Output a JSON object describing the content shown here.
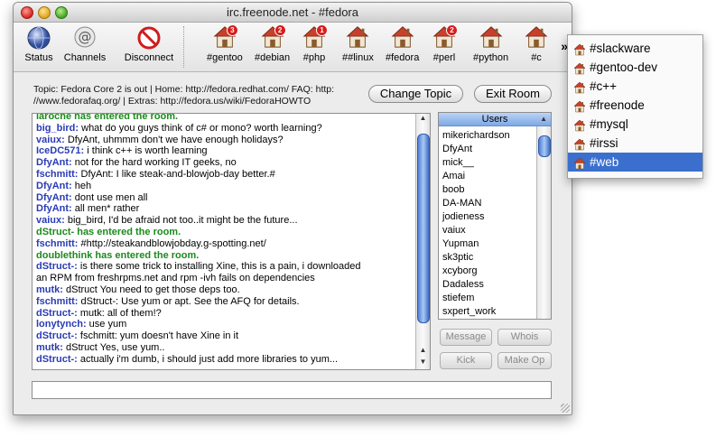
{
  "window": {
    "title": "irc.freenode.net - #fedora"
  },
  "toolbar": {
    "status_label": "Status",
    "channels_label": "Channels",
    "disconnect_label": "Disconnect",
    "overflow_glyph": "»",
    "channels": [
      {
        "name": "#gentoo",
        "badge": "3"
      },
      {
        "name": "#debian",
        "badge": "2"
      },
      {
        "name": "#php",
        "badge": "1"
      },
      {
        "name": "##linux",
        "badge": ""
      },
      {
        "name": "#fedora",
        "badge": ""
      },
      {
        "name": "#perl",
        "badge": "2"
      },
      {
        "name": "#python",
        "badge": ""
      },
      {
        "name": "#c",
        "badge": ""
      }
    ]
  },
  "topic": {
    "line1": "Topic: Fedora Core 2 is out | Home: http://fedora.redhat.com/ FAQ: http:",
    "line2": "//www.fedorafaq.org/ | Extras: http://fedora.us/wiki/FedoraHOWTO"
  },
  "buttons": {
    "change_topic": "Change Topic",
    "exit_room": "Exit Room",
    "message": "Message",
    "whois": "Whois",
    "kick": "Kick",
    "make_op": "Make Op"
  },
  "chat": [
    {
      "nick": "",
      "text": "laroche has entered the room.",
      "system": true
    },
    {
      "nick": "big_bird:",
      "text": " what do you guys think of c# or mono? worth learning?"
    },
    {
      "nick": "vaiux:",
      "text": " DfyAnt, uhmmm don't we have enough holidays?"
    },
    {
      "nick": "IceDC571:",
      "text": " i think c++ is worth learning"
    },
    {
      "nick": "DfyAnt:",
      "text": " not for the hard working IT geeks, no"
    },
    {
      "nick": "fschmitt:",
      "text": " DfyAnt: I like steak-and-blowjob-day better.#"
    },
    {
      "nick": "DfyAnt:",
      "text": " heh"
    },
    {
      "nick": "DfyAnt:",
      "text": " dont use men all"
    },
    {
      "nick": "DfyAnt:",
      "text": " all men* rather"
    },
    {
      "nick": "vaiux:",
      "text": " big_bird, I'd be afraid not too..it might be the future..."
    },
    {
      "nick": "",
      "text": "dStruct- has entered the room.",
      "system": true
    },
    {
      "nick": "fschmitt:",
      "text": " #http://steakandblowjobday.g-spotting.net/"
    },
    {
      "nick": "",
      "text": "doublethink has entered the room.",
      "system": true
    },
    {
      "nick": "dStruct-:",
      "text": " is there some trick to installing Xine, this is a pain, i downloaded"
    },
    {
      "nick": "",
      "text": "an RPM from freshrpms.net and rpm -ivh fails on dependencies"
    },
    {
      "nick": "mutk:",
      "text": " dStruct You need to get those deps too."
    },
    {
      "nick": "fschmitt:",
      "text": " dStruct-: Use yum or apt. See the AFQ for details."
    },
    {
      "nick": "dStruct-:",
      "text": " mutk: all of them!?"
    },
    {
      "nick": "lonytynch:",
      "text": " use yum"
    },
    {
      "nick": "dStruct-:",
      "text": " fschmitt: yum doesn't have Xine in it"
    },
    {
      "nick": "mutk:",
      "text": " dStruct Yes, use yum.."
    },
    {
      "nick": "dStruct-:",
      "text": " actually i'm dumb, i should just add more libraries to yum..."
    }
  ],
  "users": {
    "header": "Users",
    "names": [
      "mikerichardson",
      "DfyAnt",
      "mick__",
      "Amai",
      "boob",
      "DA-MAN",
      "jodieness",
      "vaiux",
      "Yupman",
      "sk3ptic",
      "xcyborg",
      "Dadaless",
      "stiefem",
      "sxpert_work"
    ]
  },
  "overflow_menu": {
    "items": [
      "#slackware",
      "#gentoo-dev",
      "#c++",
      "#freenode",
      "#mysql",
      "#irssi",
      "#web"
    ],
    "selected_index": 6
  },
  "colors": {
    "nick": "#2a3cb3",
    "system": "#1c8a1c",
    "menu_highlight": "#3b6fce"
  }
}
